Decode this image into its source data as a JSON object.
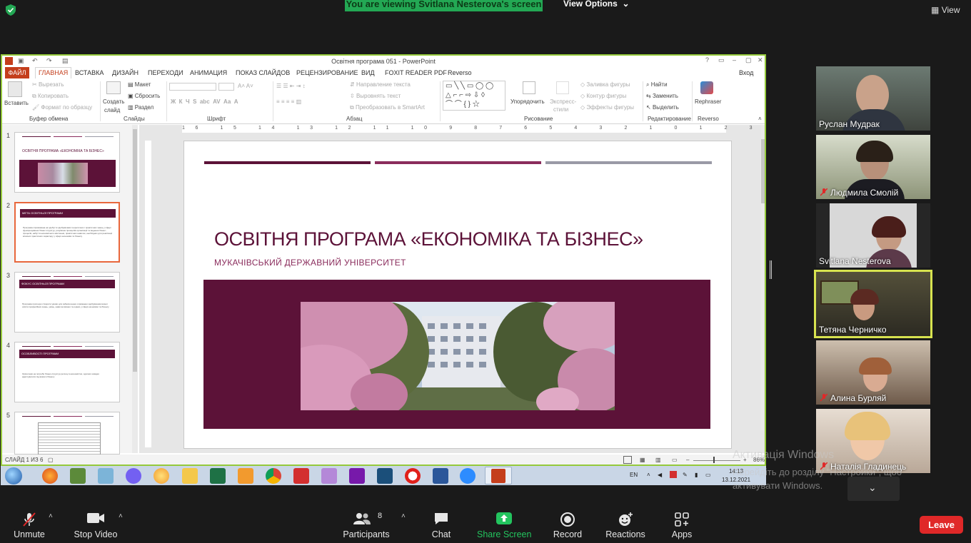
{
  "zoom": {
    "banner": "You are viewing Svitlana Nesterova's screen",
    "view_options": "View Options",
    "view_button": "View"
  },
  "ppt": {
    "window_title": "Освітня програма 051 - PowerPoint",
    "login": "Вход",
    "tabs": [
      "ФАЙЛ",
      "ГЛАВНАЯ",
      "ВСТАВКА",
      "ДИЗАЙН",
      "ПЕРЕХОДИ",
      "АНИМАЦИЯ",
      "ПОКАЗ СЛАЙДОВ",
      "РЕЦЕНЗИРОВАНИЕ",
      "ВИД",
      "FOXIT READER PDF",
      "Reverso"
    ],
    "ribbon": {
      "paste": "Вставить",
      "cut": "Вырезать",
      "copy": "Копировать",
      "format_painter": "Формат по образцу",
      "clipboard_group": "Буфер обмена",
      "create_slide": "Создать",
      "create_slide2": "слайд",
      "layout": "Макет",
      "reset": "Сбросить",
      "section": "Раздел",
      "slides_group": "Слайды",
      "font_group": "Шрифт",
      "text_direction": "Направление текста",
      "align_text": "Выровнять текст",
      "smartart": "Преобразовать в SmartArt",
      "paragraph_group": "Абзац",
      "arrange": "Упорядочить",
      "express": "Экспресс-",
      "express2": "стили",
      "shape_fill": "Заливка фигуры",
      "shape_outline": "Контур фигуры",
      "shape_effects": "Эффекты фигуры",
      "drawing_group": "Рисование",
      "find": "Найти",
      "replace": "Заменить",
      "select": "Выделить",
      "editing_group": "Редактирование",
      "rephraser": "Rephraser",
      "reverso_group": "Reverso"
    },
    "thumbnails": [
      {
        "num": "1",
        "title": "ОСВІТНЯ ПРОГРАМА «ЕКОНОМІКА ТА БІЗНЕС»"
      },
      {
        "num": "2",
        "title": "МЕТА ОСВІТНЬОЇ ПРОГРАМИ",
        "body": "Програма спрямована на здобуття здобувачами теоретичних і практичних знань у сфері функціонування бізнес-структур, розуміння принципів організації та ведення бізнес-процесів, набуття економічного мислення, практичних навичок, необхідних для реалізації власних практичних характеру у сфері економіки та бізнесу"
      },
      {
        "num": "3",
        "title": "ФОКУС ОСВІТНЬОЇ ПРОГРАМИ",
        "body": "Програма пропонує створити умови для забезпечення отримання здобувачами вищої освіти професійних знань, умінь, навичок вміння та оцінки у сфері економіки та бізнесу"
      },
      {
        "num": "4",
        "title": "ОСОБЛИВОСТІ ПРОГРАМИ",
        "body": "Орієнтація на потреби бізнес-структур регіону в економістах, здатних швидко адаптуватися під вимоги бізнесу"
      },
      {
        "num": "5",
        "title": ""
      }
    ],
    "slide": {
      "title": "ОСВІТНЯ ПРОГРАМА «ЕКОНОМІКА ТА БІЗНЕС»",
      "subtitle": "МУКАЧІВСЬКИЙ ДЕРЖАВНИЙ УНІВЕРСИТЕТ"
    },
    "status": "СЛАЙД 1 ИЗ 6",
    "zoom_pct": "86%",
    "colors": {
      "accent": "#5c1238",
      "accent2": "#8a2c5c",
      "gray": "#9a9aa6"
    }
  },
  "taskbar": {
    "lang": "EN",
    "time": "14:13",
    "date": "13.12.2021"
  },
  "watermark": {
    "line1": "Активація Windows",
    "line2": "Перейдіть до розділу \"Настройки\", щоб",
    "line3": "активувати Windows."
  },
  "participants": [
    {
      "name": "Руслан Мудрак",
      "muted": false
    },
    {
      "name": "Людмила Смолій",
      "muted": true
    },
    {
      "name": "Svitlana Nesterova",
      "muted": false
    },
    {
      "name": "Тетяна Черничко",
      "muted": false
    },
    {
      "name": "Алина Бурляй",
      "muted": true
    },
    {
      "name": "Наталія Гладинець",
      "muted": true
    }
  ],
  "controls": {
    "unmute": "Unmute",
    "stop_video": "Stop Video",
    "participants": "Participants",
    "participants_count": "8",
    "chat": "Chat",
    "share_screen": "Share Screen",
    "record": "Record",
    "reactions": "Reactions",
    "apps": "Apps",
    "leave": "Leave"
  }
}
